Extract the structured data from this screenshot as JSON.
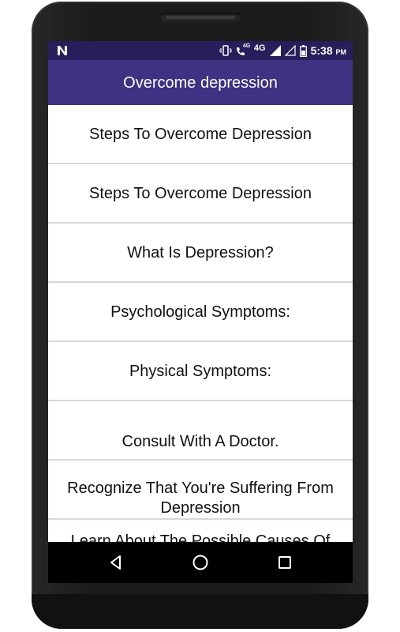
{
  "status_bar": {
    "network_type": "4G",
    "volte_label": "4G",
    "time": "5:38",
    "ampm": "PM"
  },
  "app_bar": {
    "title": "Overcome depression"
  },
  "list": {
    "items": [
      {
        "label": "Steps To Overcome Depression"
      },
      {
        "label": "Steps To Overcome Depression"
      },
      {
        "label": "What Is Depression?"
      },
      {
        "label": "Psychological Symptoms:"
      },
      {
        "label": "Physical Symptoms:"
      },
      {
        "label": "Consult With A Doctor."
      },
      {
        "label": "Recognize That You're Suffering From Depression"
      },
      {
        "label": "Learn About The Possible Causes Of"
      }
    ]
  },
  "nav_bar": {
    "icons": [
      "back-icon",
      "home-icon",
      "recents-icon"
    ]
  },
  "colors": {
    "status_bar": "#271e5b",
    "app_bar": "#3f3283",
    "divider": "#d9d7df"
  }
}
